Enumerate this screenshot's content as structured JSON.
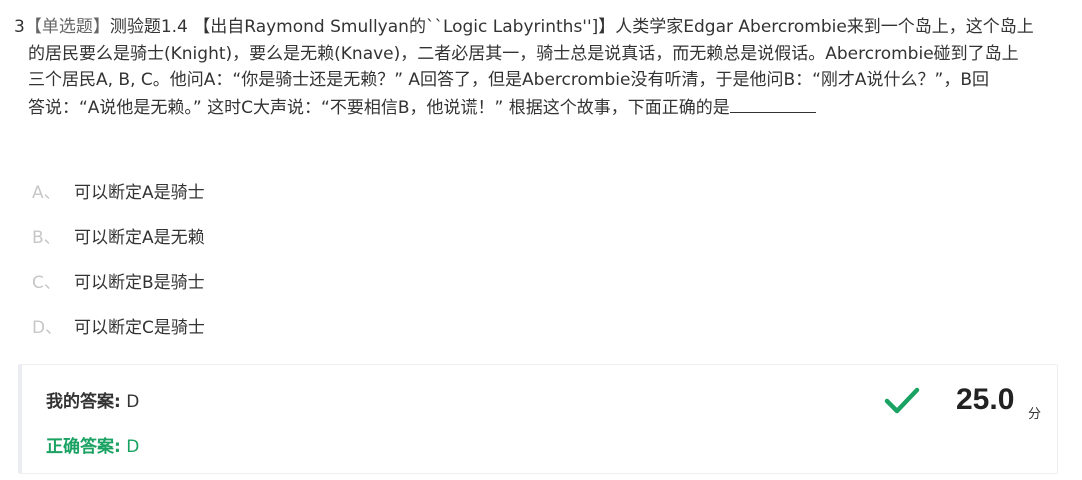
{
  "question": {
    "number": "3",
    "type": "【单选题】",
    "lines": [
      "测验题1.4 【出自Raymond Smullyan的``Logic Labyrinths'']】人类学家Edgar Abercrombie来到一个岛上，这个岛上",
      "的居民要么是骑士(Knight)，要么是无赖(Knave)，二者必居其一，骑士总是说真话，而无赖总是说假话。Abercrombie碰到了岛上",
      "三个居民A, B, C。他问A：“你是骑士还是无赖？” A回答了，但是Abercrombie没有听清，于是他问B：“刚才A说什么？”，B回",
      "答说：“A说他是无赖。” 这时C大声说：“不要相信B，他说谎！” 根据这个故事，下面正确的是"
    ]
  },
  "options": [
    {
      "letter": "A、",
      "text": "可以断定A是骑士"
    },
    {
      "letter": "B、",
      "text": "可以断定A是无赖"
    },
    {
      "letter": "C、",
      "text": "可以断定B是骑士"
    },
    {
      "letter": "D、",
      "text": "可以断定C是骑士"
    }
  ],
  "answer": {
    "my_label": "我的答案:",
    "my_value": "D",
    "correct_label": "正确答案:",
    "correct_value": "D",
    "score": "25.0",
    "score_unit": "分",
    "check_color": "#1aa262"
  }
}
